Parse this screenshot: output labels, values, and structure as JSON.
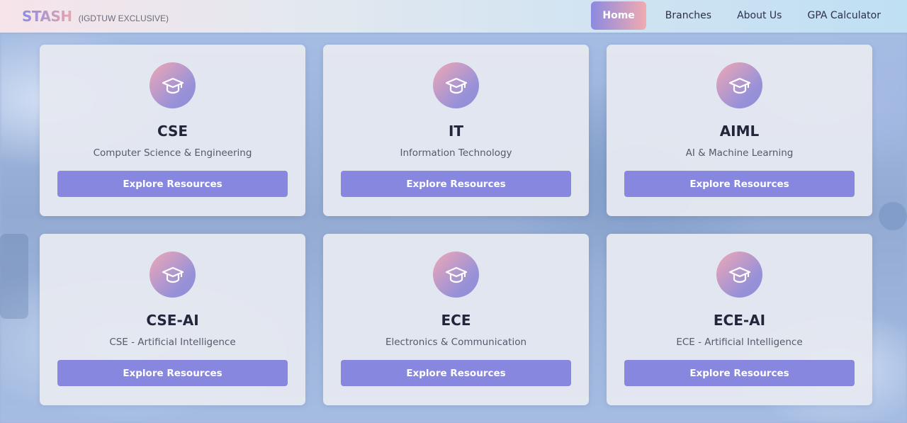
{
  "brand": {
    "logo": "STASH",
    "tagline": "(IGDTUW EXCLUSIVE)"
  },
  "nav": {
    "items": [
      {
        "label": "Home",
        "active": true
      },
      {
        "label": "Branches",
        "active": false
      },
      {
        "label": "About Us",
        "active": false
      },
      {
        "label": "GPA Calculator",
        "active": false
      }
    ]
  },
  "cards": [
    {
      "title": "CSE",
      "subtitle": "Computer Science & Engineering",
      "button": "Explore Resources",
      "icon": "graduation-cap-icon"
    },
    {
      "title": "IT",
      "subtitle": "Information Technology",
      "button": "Explore Resources",
      "icon": "graduation-cap-icon"
    },
    {
      "title": "AIML",
      "subtitle": "AI & Machine Learning",
      "button": "Explore Resources",
      "icon": "graduation-cap-icon"
    },
    {
      "title": "CSE-AI",
      "subtitle": "CSE - Artificial Intelligence",
      "button": "Explore Resources",
      "icon": "graduation-cap-icon"
    },
    {
      "title": "ECE",
      "subtitle": "Electronics & Communication",
      "button": "Explore Resources",
      "icon": "graduation-cap-icon"
    },
    {
      "title": "ECE-AI",
      "subtitle": "ECE - Artificial Intelligence",
      "button": "Explore Resources",
      "icon": "graduation-cap-icon"
    }
  ],
  "colors": {
    "accent": "#8787df",
    "gradient_start": "#8b8ae0",
    "gradient_end": "#f1aab0",
    "card_bg": "#e5e8f0",
    "title_text": "#22263a"
  }
}
